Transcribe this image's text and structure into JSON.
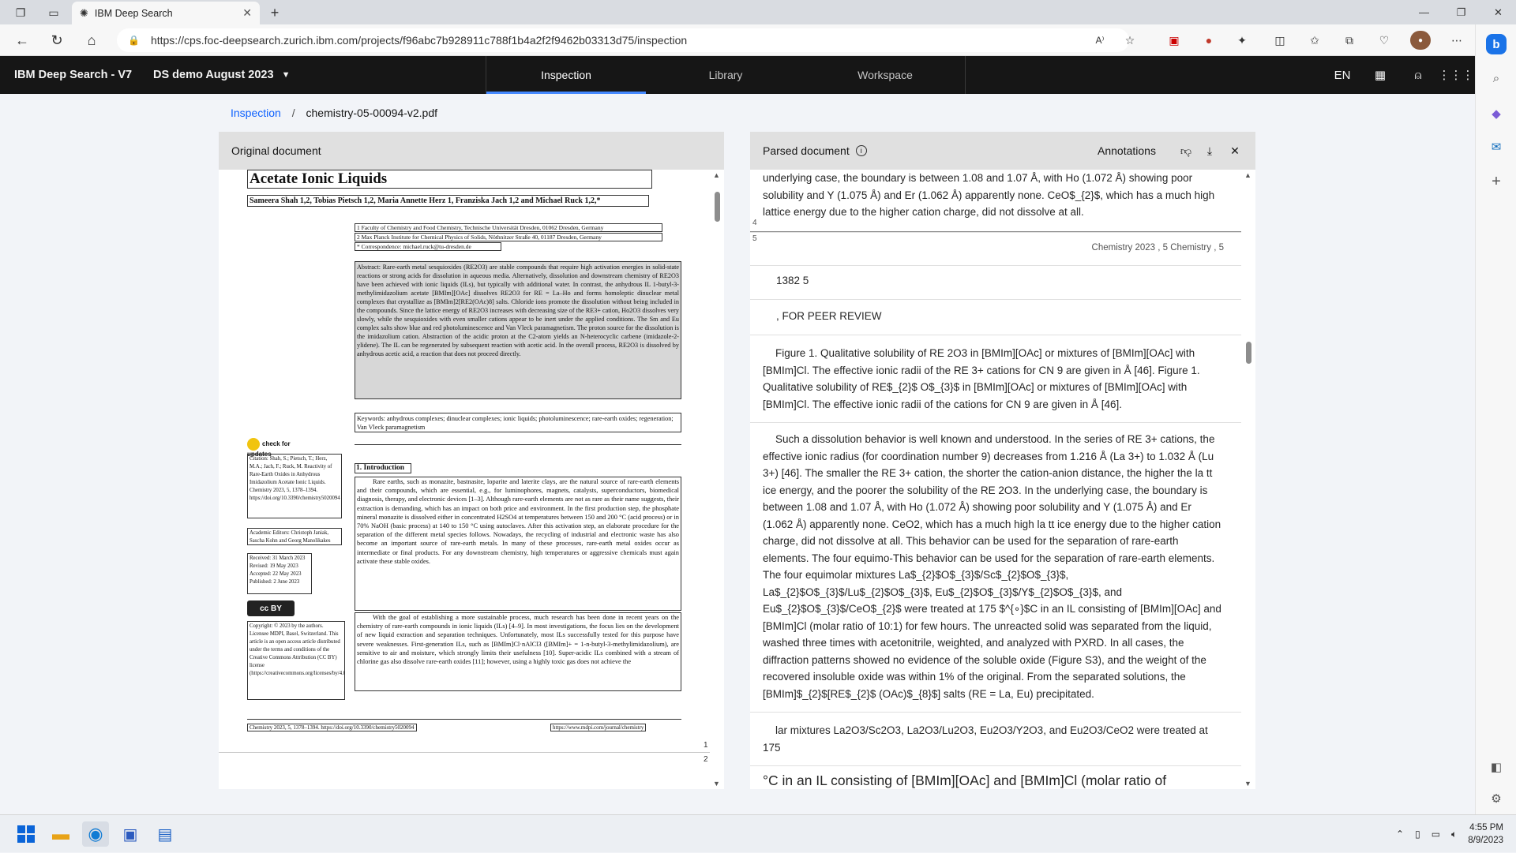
{
  "browser": {
    "tab_title": "IBM Deep Search",
    "url": "https://cps.foc-deepsearch.zurich.ibm.com/projects/f96abc7b928911c788f1b4a2f2f9462b03313d75/inspection"
  },
  "app": {
    "brand": "IBM Deep Search - V7",
    "project": "DS demo August 2023",
    "nav": [
      "Inspection",
      "Library",
      "Workspace"
    ],
    "active_nav": "Inspection",
    "language": "EN"
  },
  "breadcrumb": {
    "root": "Inspection",
    "current": "chemistry-05-00094-v2.pdf"
  },
  "left_panel": {
    "title": "Original document",
    "pdf": {
      "title": "Acetate Ionic Liquids",
      "authors": "Sameera Shah 1,2, Tobias Pietsch 1,2, Maria Annette Herz 1, Franziska Jach 1,2 and Michael Ruck 1,2,*",
      "affiliations": [
        "1   Faculty of Chemistry and Food Chemistry, Technische Universität Dresden, 01062 Dresden, Germany",
        "2   Max Planck Institute for Chemical Physics of Solids, Nöthnitzer Straße 40, 01187 Dresden, Germany",
        "*   Correspondence: michael.ruck@tu-dresden.de"
      ],
      "abstract": "Abstract: Rare-earth metal sesquioxides (RE2O3) are stable compounds that require high activation energies in solid-state reactions or strong acids for dissolution in aqueous media. Alternatively, dissolution and downstream chemistry of RE2O3 have been achieved with ionic liquids (ILs), but typically with additional water. In contrast, the anhydrous IL 1-butyl-3-methylimidazolium acetate [BMIm][OAc] dissolves RE2O3 for RE = La–Ho and forms homoleptic dinuclear metal complexes that crystallize as [BMIm]2[RE2(OAc)8] salts. Chloride ions promote the dissolution without being included in the compounds. Since the lattice energy of RE2O3 increases with decreasing size of the RE3+ cation, Ho2O3 dissolves very slowly, while the sesquioxides with even smaller cations appear to be inert under the applied conditions. The Sm and Eu complex salts show blue and red photoluminescence and Van Vleck paramagnetism. The proton source for the dissolution is the imidazolium cation. Abstraction of the acidic proton at the C2-atom yields an N-heterocyclic carbene (imidazole-2-ylidene). The IL can be regenerated by subsequent reaction with acetic acid. In the overall process, RE2O3 is dissolved by anhydrous acetic acid, a reaction that does not proceed directly.",
      "keywords": "Keywords: anhydrous complexes; dinuclear complexes; ionic liquids; photoluminescence; rare-earth oxides; regeneration; Van Vleck paramagnetism",
      "check_updates": "check for updates",
      "citation": "Citation: Shah, S.; Pietsch, T.; Herz, M.A.; Jach, F.; Ruck, M. Reactivity of Rare-Earth Oxides in Anhydrous Imidazolium Acetate Ionic Liquids. Chemistry 2023, 5, 1378–1394. https://doi.org/10.3390/chemistry5020094",
      "editors": "Academic Editors: Christoph Janiak, Sascha Kohn and Georg Manolikakes",
      "dates": "Received: 31 March 2023 Revised: 19 May 2023 Accepted: 22 May 2023 Published: 2 June 2023",
      "license_badge": "cc  BY",
      "copyright": "Copyright: © 2023 by the authors. Licensee MDPI, Basel, Switzerland. This article is an open access article distributed under the terms and conditions of the Creative Commons Attribution (CC BY) license (https://creativecommons.org/licenses/by/4.0/).",
      "intro_heading": "1. Introduction",
      "intro_p1": "Rare earths, such as monazite, bastnasite, loparite and laterite clays, are the natural source of rare-earth elements and their compounds, which are essential, e.g., for luminophores, magnets, catalysts, superconductors, biomedical diagnosis, therapy, and electronic devices [1–3]. Although rare-earth elements are not as rare as their name suggests, their extraction is demanding, which has an impact on both price and environment. In the first production step, the phosphate mineral monazite is dissolved either in concentrated H2SO4 at temperatures between 150 and 200 °C (acid process) or in 70% NaOH (basic process) at 140 to 150 °C using autoclaves. After this activation step, an elaborate procedure for the separation of the different metal species follows. Nowadays, the recycling of industrial and electronic waste has also become an important source of rare-earth metals. In many of these processes, rare-earth metal oxides occur as intermediate or final products. For any downstream chemistry, high temperatures or aggressive chemicals must again activate these stable oxides.",
      "intro_p2": "With the goal of establishing a more sustainable process, much research has been done in recent years on the chemistry of rare-earth compounds in ionic liquids (ILs) [4–9]. In most investigations, the focus lies on the development of new liquid extraction and separation techniques. Unfortunately, most ILs successfully tested for this purpose have severe weaknesses. First-generation ILs, such as [BMIm]Cl·nAlCl3 ([BMIm]+ = 1-n-butyl-3-methylimidazolium), are sensitive to air and moisture, which strongly limits their usefulness [10]. Super-acidic ILs combined with a stream of chlorine gas also dissolve rare-earth oxides [11]; however, using a highly toxic gas does not achieve the",
      "footer_left": "Chemistry 2023, 5, 1378–1394. https://doi.org/10.3390/chemistry5020094",
      "footer_right": "https://www.mdpi.com/journal/chemistry",
      "page_numbers": [
        "1",
        "2"
      ]
    }
  },
  "right_panel": {
    "title": "Parsed document",
    "annotations_label": "Annotations",
    "blocks": [
      {
        "text": "underlying case, the boundary is between 1.08 and 1.07 Å, with Ho (1.072 Å) showing poor solubility and Y (1.075 Å) and Er (1.062 Å) apparently none. CeO$_{2}$, which has a much high lattice energy due to the higher cation charge, did not dissolve at all."
      },
      {
        "text": "Chemistry 2023 , 5 Chemistry , 5"
      },
      {
        "text": "1382 5"
      },
      {
        "text": ", FOR PEER REVIEW"
      },
      {
        "text": "Figure 1. Qualitative solubility of RE 2O3 in [BMIm][OAc] or mixtures of [BMIm][OAc] with [BMIm]Cl. The effective ionic radii of the RE 3+ cations for CN 9 are given in Å [46]. Figure 1. Qualitative solubility of RE$_{2}$ O$_{3}$ in [BMIm][OAc] or mixtures of [BMIm][OAc] with [BMIm]Cl. The effective ionic radii of the cations for CN 9 are given in Å [46]."
      },
      {
        "text": "Such a dissolution behavior is well known and understood. In the series of RE 3+ cations, the effective ionic radius (for coordination number 9) decreases from 1.216 Å (La 3+) to 1.032 Å (Lu 3+) [46]. The smaller the RE 3+ cation, the shorter the cation-anion distance, the higher the la tt ice energy, and the poorer the solubility of the RE 2O3. In the underlying case, the boundary is between 1.08 and 1.07 Å, with Ho (1.072 Å) showing poor solubility and Y (1.075 Å) and Er (1.062 Å) apparently none. CeO2, which has a much high la tt ice energy due to the higher cation charge, did not dissolve at all. This behavior can be used for the separation of rare-earth elements. The four equimo-This behavior can be used for the separation of rare-earth elements. The four equimolar mixtures La$_{2}$O$_{3}$/Sc$_{2}$O$_{3}$, La$_{2}$O$_{3}$/Lu$_{2}$O$_{3}$, Eu$_{2}$O$_{3}$/Y$_{2}$O$_{3}$, and Eu$_{2}$O$_{3}$/CeO$_{2}$ were treated at 175 $^{∘}$C in an IL consisting of [BMIm][OAc] and [BMIm]Cl (molar ratio of 10:1) for few hours. The unreacted solid was separated from the liquid, washed three times with acetonitrile, weighted, and analyzed with PXRD. In all cases, the diffraction patterns showed no evidence of the soluble oxide (Figure S3), and the weight of the recovered insoluble oxide was within 1% of the original. From the separated solutions, the [BMIm]$_{2}$[RE$_{2}$ (OAc)$_{8}$] salts (RE = La, Eu) precipitated."
      },
      {
        "text": "lar mixtures La2O3/Sc2O3, La2O3/Lu2O3, Eu2O3/Y2O3, and Eu2O3/CeO2 were treated at 175"
      },
      {
        "text": "°C in an IL consisting of [BMIm][OAc] and [BMIm]Cl (molar ratio of"
      }
    ],
    "line_markers": [
      "4",
      "5"
    ]
  },
  "taskbar": {
    "time": "4:55 PM",
    "date": "8/9/2023"
  }
}
